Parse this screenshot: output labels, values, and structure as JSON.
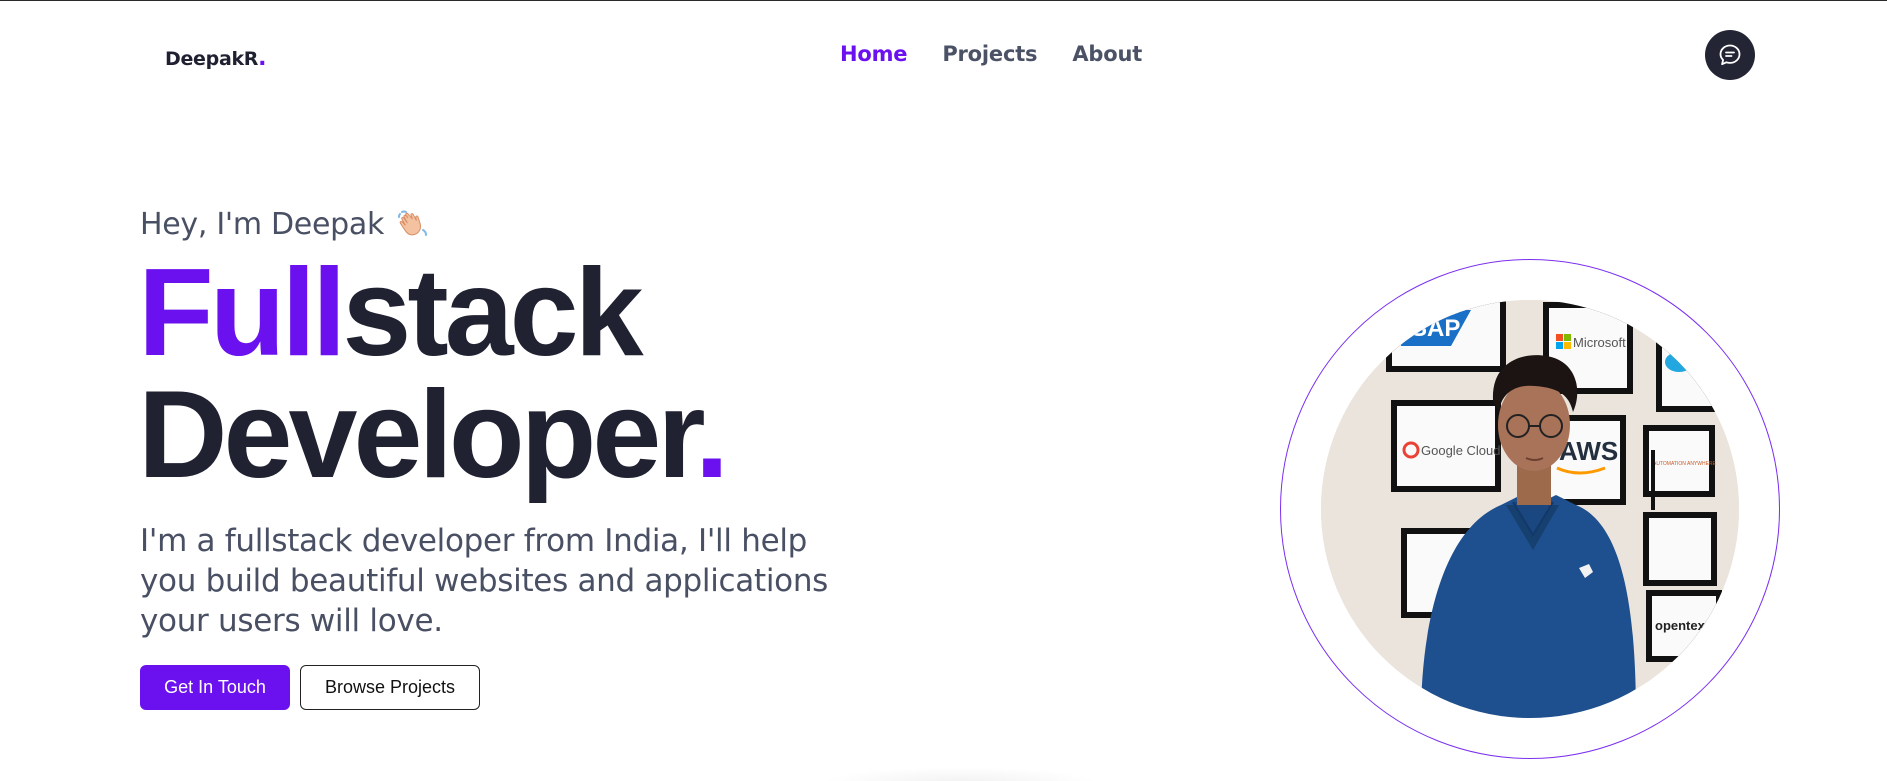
{
  "nav": {
    "logo": "DeepakR",
    "logo_dot": ".",
    "links": [
      {
        "label": "Home",
        "active": true
      },
      {
        "label": "Projects",
        "active": false
      },
      {
        "label": "About",
        "active": false
      }
    ],
    "chat_icon": "chat-bubble-icon"
  },
  "hero": {
    "greeting": "Hey, I'm Deepak",
    "wave_icon": "waving-hand-icon",
    "title_accent": "Full",
    "title_rest": "stack",
    "title_line2": "Developer",
    "title_dot": ".",
    "lead": "I'm a fullstack developer from India, I'll help you build beautiful websites and applications your users will love.",
    "primary_button": "Get In Touch",
    "secondary_button": "Browse Projects"
  },
  "portrait": {
    "wall_logos": [
      "SAP",
      "Microsoft",
      "Google Cloud",
      "AWS",
      "AUTOMATION ANYWHERE",
      "opentext"
    ]
  },
  "colors": {
    "accent": "#6b11f0",
    "text_dark": "#202232",
    "text_muted": "#4a5064",
    "chat_button": "#232534"
  }
}
